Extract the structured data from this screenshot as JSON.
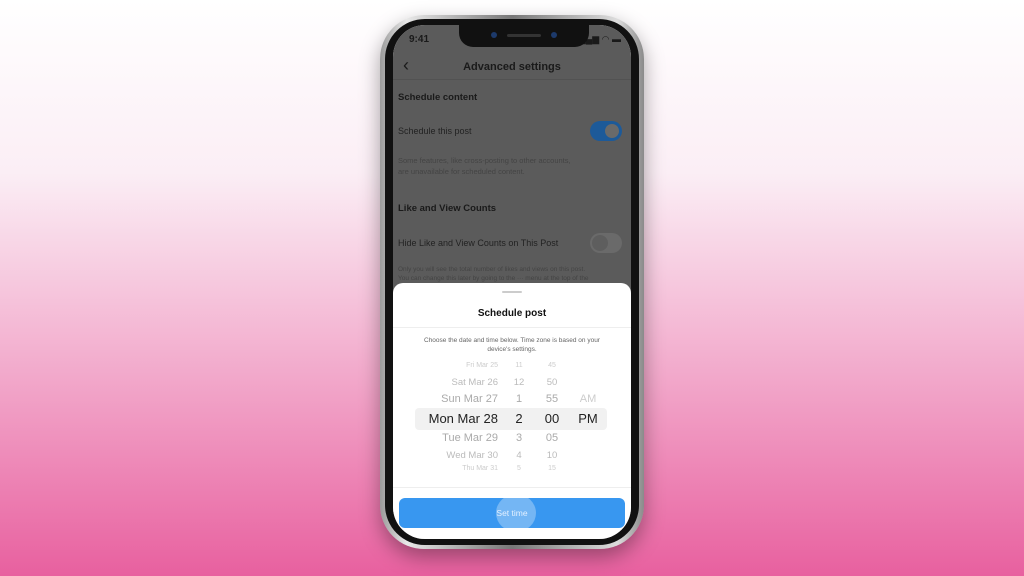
{
  "status_bar": {
    "time": "9:41",
    "icons": "signal wifi battery"
  },
  "header": {
    "title": "Advanced settings",
    "back_icon": "chevron-left-icon"
  },
  "schedule_section": {
    "title": "Schedule content",
    "toggle_label": "Schedule this post",
    "toggle_on": true,
    "note_line1": "Some features, like cross-posting to other accounts,",
    "note_line2": "are unavailable for scheduled content."
  },
  "counts_section": {
    "title": "Like and View Counts",
    "toggle_label": "Hide Like and View Counts on This Post",
    "toggle_on": false,
    "note_line1": "Only you will see the total number of likes and views on this post.",
    "note_line2": "You can change this later by going to the ··· menu at the top of the"
  },
  "sheet": {
    "title": "Schedule post",
    "description": "Choose the date and time below. Time zone is based on your device's settings.",
    "picker_rows": [
      {
        "date": "Fri Mar 25",
        "hour": "11",
        "minute": "45",
        "ampm": ""
      },
      {
        "date": "Sat Mar 26",
        "hour": "12",
        "minute": "50",
        "ampm": ""
      },
      {
        "date": "Sun Mar 27",
        "hour": "1",
        "minute": "55",
        "ampm": "AM"
      },
      {
        "date": "Mon Mar 28",
        "hour": "2",
        "minute": "00",
        "ampm": "PM"
      },
      {
        "date": "Tue Mar 29",
        "hour": "3",
        "minute": "05",
        "ampm": ""
      },
      {
        "date": "Wed Mar 30",
        "hour": "4",
        "minute": "10",
        "ampm": ""
      },
      {
        "date": "Thu Mar 31",
        "hour": "5",
        "minute": "15",
        "ampm": ""
      }
    ],
    "button_label": "Set time"
  },
  "colors": {
    "accent": "#3897f0",
    "toggle_on": "#1f6fc9"
  }
}
